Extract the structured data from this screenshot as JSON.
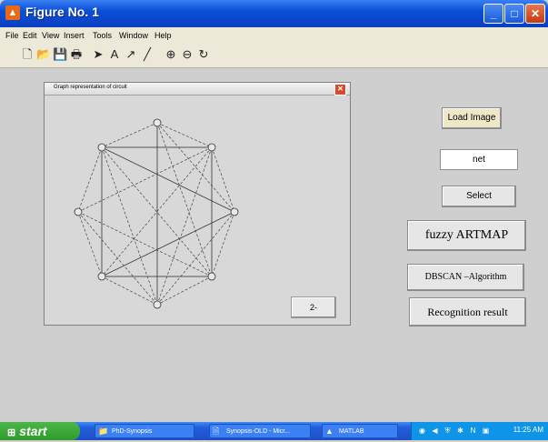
{
  "window": {
    "title": "Figure No. 1",
    "controls": [
      "minimize-icon",
      "maximize-icon",
      "close-icon"
    ]
  },
  "menu": [
    "File",
    "Edit",
    "View",
    "Insert",
    "Tools",
    "Window",
    "Help"
  ],
  "toolbar": {
    "tools": [
      "new-file-icon",
      "open-folder-icon",
      "save-icon",
      "print-icon",
      "pointer-arrow-icon",
      "text-tool-icon",
      "arrow-tool-icon",
      "line-tool-icon",
      "zoom-in-icon",
      "zoom-out-icon",
      "rotate-icon"
    ]
  },
  "graph_window": {
    "title": "Graph representation of circuit",
    "button_label": "2-"
  },
  "buttons": {
    "load_image": "Load Image",
    "net_value": "net",
    "select": "Select",
    "fuzzy": "fuzzy ARTMAP",
    "dbscan": "DBSCAN –Algorithm",
    "recognition": "Recognition result"
  },
  "taskbar": {
    "start": "start",
    "items": [
      "PhD-Synopsis",
      "Synopsis-OLD - Micr...",
      "MATLAB"
    ],
    "clock": "11:25 AM"
  },
  "colors": {
    "titlebar": "#0a4fd8",
    "taskbar": "#245edb",
    "start_button": "#2f9a2c",
    "figure_background": "#cfcfcf"
  }
}
